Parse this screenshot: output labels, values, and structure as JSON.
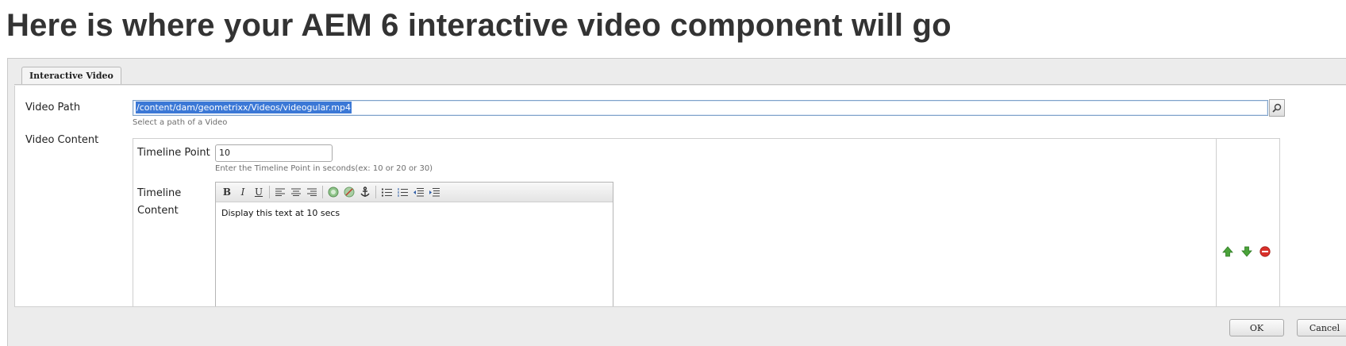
{
  "page": {
    "heading": "Here is where your AEM 6 interactive video component will go"
  },
  "dialog": {
    "tab_label": "Interactive Video",
    "video_path": {
      "label": "Video Path",
      "value": "/content/dam/geometrixx/Videos/videogular.mp4",
      "hint": "Select a path of a Video"
    },
    "video_content": {
      "label": "Video Content",
      "timeline_point": {
        "label": "Timeline Point",
        "value": "10",
        "hint": "Enter the Timeline Point in seconds(ex: 10 or 20 or 30)"
      },
      "timeline_content": {
        "label_line1": "Timeline",
        "label_line2": "Content",
        "toolbar": {
          "bold": "B",
          "italic": "I",
          "underline": "U"
        },
        "text": "Display this text at 10 secs"
      }
    },
    "buttons": {
      "ok": "OK",
      "cancel": "Cancel"
    }
  },
  "icons": {
    "search": "search-icon",
    "move_up": "arrow-up-icon",
    "move_down": "arrow-down-icon",
    "remove": "remove-icon",
    "align_left": "align-left-icon",
    "align_center": "align-center-icon",
    "align_right": "align-right-icon",
    "link": "link-icon",
    "unlink": "unlink-icon",
    "anchor": "anchor-icon",
    "bullet_list": "bullet-list-icon",
    "numbered_list": "numbered-list-icon",
    "outdent": "outdent-icon",
    "indent": "indent-icon"
  },
  "colors": {
    "selection": "#3b78d6",
    "move_arrows": "#4aa33a",
    "remove": "#d9302a"
  }
}
